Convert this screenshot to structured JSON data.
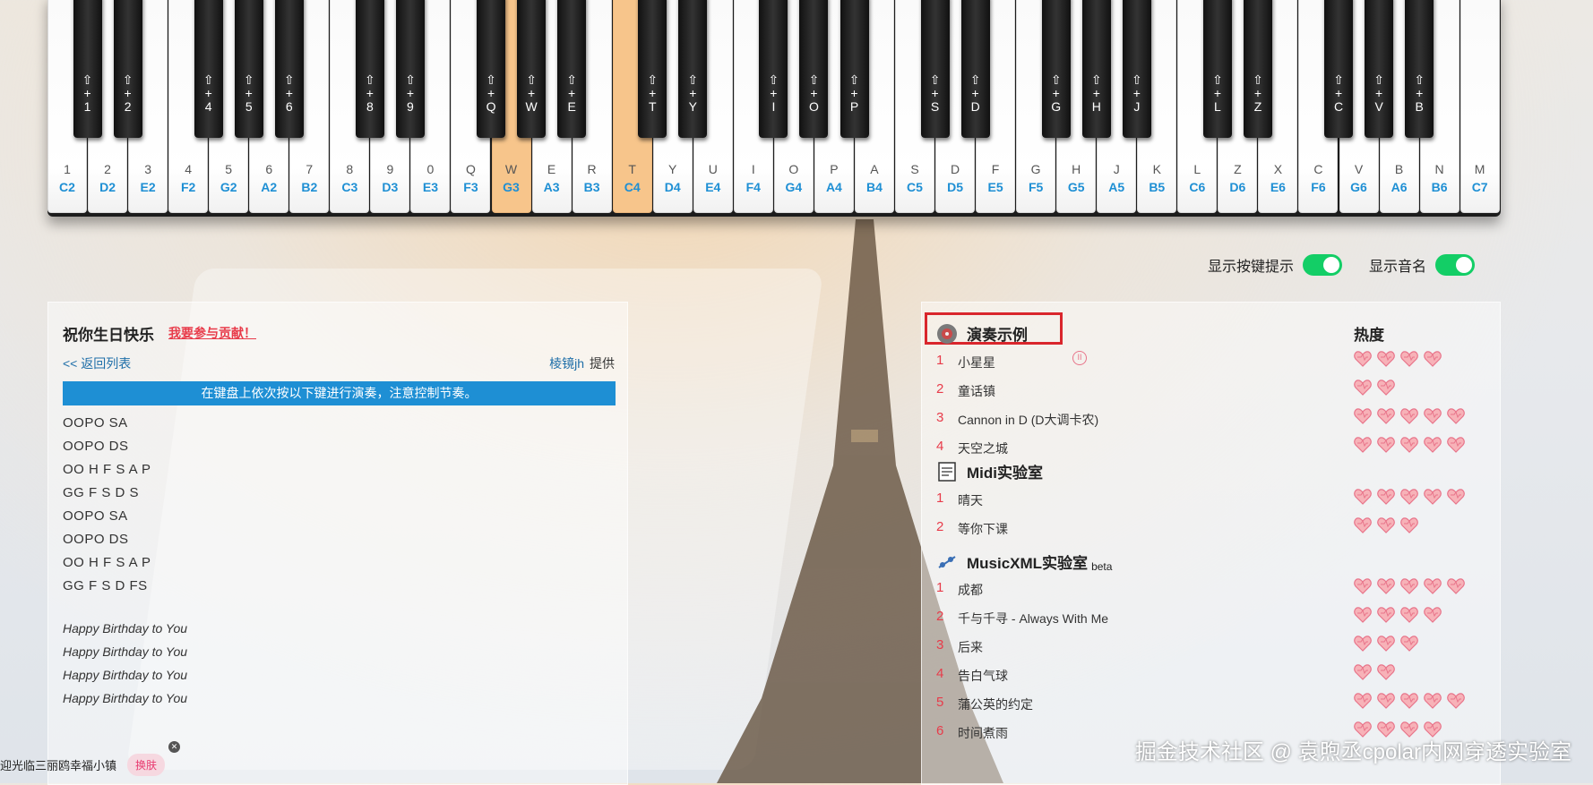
{
  "keyboard": {
    "white_keys": [
      {
        "key": "1",
        "note": "C2"
      },
      {
        "key": "2",
        "note": "D2"
      },
      {
        "key": "3",
        "note": "E2"
      },
      {
        "key": "4",
        "note": "F2"
      },
      {
        "key": "5",
        "note": "G2"
      },
      {
        "key": "6",
        "note": "A2"
      },
      {
        "key": "7",
        "note": "B2"
      },
      {
        "key": "8",
        "note": "C3"
      },
      {
        "key": "9",
        "note": "D3"
      },
      {
        "key": "0",
        "note": "E3"
      },
      {
        "key": "Q",
        "note": "F3"
      },
      {
        "key": "W",
        "note": "G3",
        "active": true
      },
      {
        "key": "E",
        "note": "A3"
      },
      {
        "key": "R",
        "note": "B3"
      },
      {
        "key": "T",
        "note": "C4",
        "active": true
      },
      {
        "key": "Y",
        "note": "D4"
      },
      {
        "key": "U",
        "note": "E4"
      },
      {
        "key": "I",
        "note": "F4"
      },
      {
        "key": "O",
        "note": "G4"
      },
      {
        "key": "P",
        "note": "A4"
      },
      {
        "key": "A",
        "note": "B4"
      },
      {
        "key": "S",
        "note": "C5"
      },
      {
        "key": "D",
        "note": "D5"
      },
      {
        "key": "F",
        "note": "E5"
      },
      {
        "key": "G",
        "note": "F5"
      },
      {
        "key": "H",
        "note": "G5"
      },
      {
        "key": "J",
        "note": "A5"
      },
      {
        "key": "K",
        "note": "B5"
      },
      {
        "key": "L",
        "note": "C6"
      },
      {
        "key": "Z",
        "note": "D6"
      },
      {
        "key": "X",
        "note": "E6"
      },
      {
        "key": "C",
        "note": "F6"
      },
      {
        "key": "V",
        "note": "G6"
      },
      {
        "key": "B",
        "note": "A6"
      },
      {
        "key": "N",
        "note": "B6"
      },
      {
        "key": "M",
        "note": "C7"
      }
    ],
    "black_keys": [
      {
        "after": 0,
        "label": "1"
      },
      {
        "after": 1,
        "label": "2"
      },
      {
        "after": 3,
        "label": "4"
      },
      {
        "after": 4,
        "label": "5"
      },
      {
        "after": 5,
        "label": "6"
      },
      {
        "after": 7,
        "label": "8"
      },
      {
        "after": 8,
        "label": "9"
      },
      {
        "after": 10,
        "label": "Q"
      },
      {
        "after": 11,
        "label": "W"
      },
      {
        "after": 12,
        "label": "E"
      },
      {
        "after": 14,
        "label": "T"
      },
      {
        "after": 15,
        "label": "Y"
      },
      {
        "after": 17,
        "label": "I"
      },
      {
        "after": 18,
        "label": "O"
      },
      {
        "after": 19,
        "label": "P"
      },
      {
        "after": 21,
        "label": "S"
      },
      {
        "after": 22,
        "label": "D"
      },
      {
        "after": 24,
        "label": "G"
      },
      {
        "after": 25,
        "label": "H"
      },
      {
        "after": 26,
        "label": "J"
      },
      {
        "after": 28,
        "label": "L"
      },
      {
        "after": 29,
        "label": "Z"
      },
      {
        "after": 31,
        "label": "C"
      },
      {
        "after": 32,
        "label": "V"
      },
      {
        "after": 33,
        "label": "B"
      }
    ],
    "shift_prefix": "⇧",
    "plus": "+"
  },
  "toggles": {
    "key_hint_label": "显示按键提示",
    "note_name_label": "显示音名"
  },
  "song": {
    "title": "祝你生日快乐",
    "contribute": "我要参与贡献！",
    "back": "<< 返回列表",
    "author": "棱镜jh",
    "provided": "提供",
    "banner": "在键盘上依次按以下键进行演奏，注意控制节奏。",
    "keys": [
      "OOPO SA",
      "OOPO DS",
      "OO H F S A P",
      "GG F S D S",
      "OOPO SA",
      "OOPO DS",
      "OO H F S A P",
      "GG F S D FS"
    ],
    "lyrics": [
      "Happy Birthday to You",
      "Happy Birthday to You",
      "Happy Birthday to You",
      "Happy Birthday to You"
    ]
  },
  "right": {
    "hot_label": "热度",
    "sections": [
      {
        "title": "演奏示例",
        "beta": "",
        "items": [
          {
            "title": "小星星",
            "hearts": 4,
            "playing": true
          },
          {
            "title": "童话镇",
            "hearts": 2
          },
          {
            "title": "Cannon in D (D大调卡农)",
            "hearts": 5
          },
          {
            "title": "天空之城",
            "hearts": 5
          }
        ]
      },
      {
        "title": "Midi实验室",
        "beta": "",
        "items": [
          {
            "title": "晴天",
            "hearts": 5
          },
          {
            "title": "等你下课",
            "hearts": 3
          }
        ]
      },
      {
        "title": "MusicXML实验室",
        "beta": "beta",
        "items": [
          {
            "title": "成都",
            "hearts": 5
          },
          {
            "title": "千与千寻 - Always With Me",
            "hearts": 4
          },
          {
            "title": "后来",
            "hearts": 3
          },
          {
            "title": "告白气球",
            "hearts": 2
          },
          {
            "title": "蒲公英的约定",
            "hearts": 5
          },
          {
            "title": "时间煮雨",
            "hearts": 4
          }
        ]
      }
    ]
  },
  "bottom": {
    "tip": "迎光临三丽鸥幸福小镇",
    "skin": "换肤",
    "close": "✕"
  },
  "watermark": "掘金技术社区 @ 袁煦丞cpolar内网穿透实验室",
  "colors": {
    "accent": "#1e8fd4",
    "active_key": "#f7c58b",
    "toggle": "#13ce66",
    "index": "#e83b4a"
  }
}
